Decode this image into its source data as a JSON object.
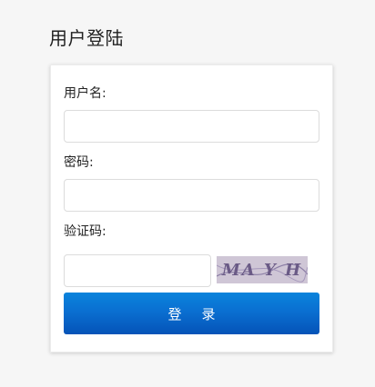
{
  "page": {
    "title": "用户登陆"
  },
  "form": {
    "username_label": "用户名:",
    "username_value": "",
    "password_label": "密码:",
    "password_value": "",
    "captcha_label": "验证码:",
    "captcha_value": "",
    "captcha_text": "MA Y H",
    "submit_label": "登录"
  },
  "colors": {
    "button_top": "#0a84dc",
    "button_bottom": "#0553b8",
    "captcha_bg": "#cfc6d6",
    "captcha_text": "#6a5a86"
  }
}
